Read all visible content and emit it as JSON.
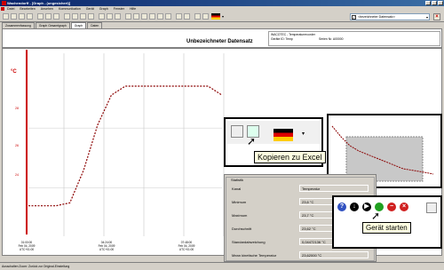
{
  "window": {
    "title": "Wachendorff - [Graph - (ungesichert)]"
  },
  "menu": [
    "Datei",
    "Bearbeiten",
    "Ansehen",
    "Kommunikation",
    "Gerät",
    "Graph",
    "Fenster",
    "Hilfe"
  ],
  "sensor_select": {
    "value": "<bezeichneter Datensatz>",
    "checked": "✓"
  },
  "tabs": [
    {
      "label": "Zusammenfassung",
      "active": false
    },
    {
      "label": "Graph Gesamtgraph",
      "active": false
    },
    {
      "label": "Graph",
      "active": true
    },
    {
      "label": "Daten",
      "active": false
    }
  ],
  "dataset": {
    "title": "Unbezeichneter Datensatz",
    "device": "WACOTEC - Temperaturrecorder",
    "device_id": "Geräte ID: Temp",
    "serial": "Serien Nr. A00000"
  },
  "chart_data": {
    "type": "line",
    "ylabel": "°C",
    "yticks": [
      "28",
      "26",
      "24"
    ],
    "xticks": [
      "01:00:00\nFeb 04, 2009\nUTC+01:00",
      "04:24:00\nFeb 04, 2009\nUTC+01:00",
      "07:48:00\nFeb 04, 2009\nUTC+01:00"
    ],
    "series": [
      {
        "color": "#8b0000",
        "x": [
          0,
          1,
          2,
          3,
          4,
          5,
          6,
          7,
          8,
          9,
          10,
          11,
          12,
          13,
          14
        ],
        "values": [
          23.4,
          23.4,
          23.4,
          23.5,
          24.6,
          26.1,
          27.1,
          27.4,
          27.4,
          27.4,
          27.4,
          27.4,
          27.4,
          27.4,
          27.1
        ]
      }
    ]
  },
  "excel_callout": {
    "tooltip": "Kopieren zu Excel"
  },
  "statistics": {
    "title": "Statistik",
    "rows": [
      {
        "label": "Kanal",
        "value": "Temperatur"
      },
      {
        "label": "Minimum",
        "value": "23,6 °C"
      },
      {
        "label": "Maximum",
        "value": "23,7 °C"
      },
      {
        "label": "Durchschnitt",
        "value": "23,62 °C"
      },
      {
        "label": "Standardabweichung",
        "value": "0,04472136 °C"
      },
      {
        "label": "Mean kinetische Temperatur",
        "value": "23,62000 °C"
      }
    ]
  },
  "start_callout": {
    "tooltip": "Gerät starten"
  },
  "status": {
    "text": "Ausschalten Zoom: Zurück zur Original-Einstellung"
  },
  "colors": {
    "titlebar": "#0a246a",
    "curve": "#8b0000",
    "axis_red": "#cc0000"
  }
}
